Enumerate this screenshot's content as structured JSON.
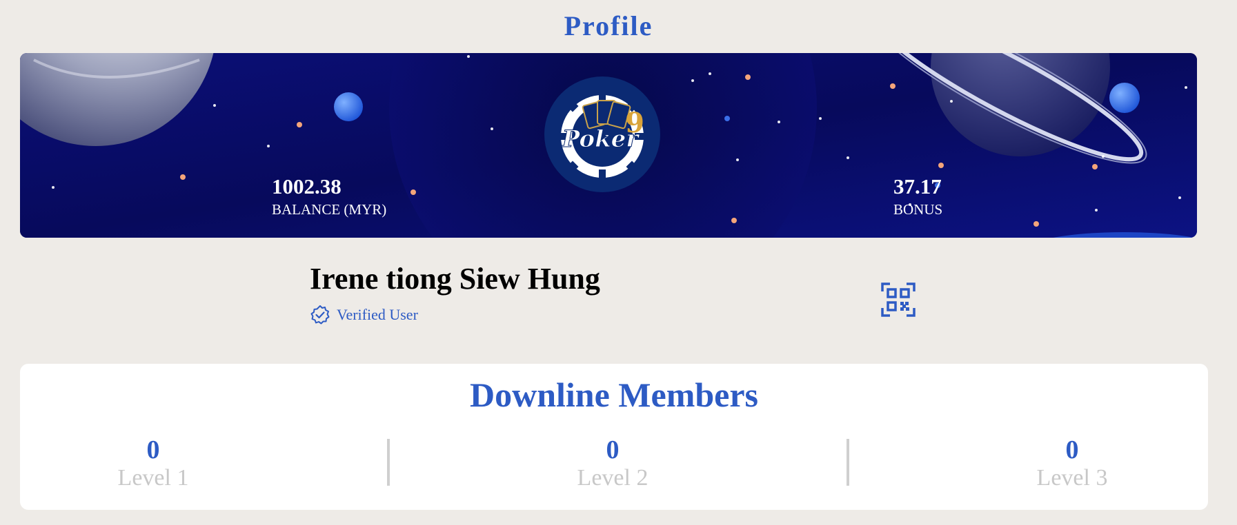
{
  "page": {
    "title": "Profile"
  },
  "banner": {
    "logo_text": "Poker9",
    "balance": {
      "value": "1002.38",
      "label": "BALANCE (MYR)"
    },
    "bonus": {
      "value": "37.17",
      "label": "BONUS"
    }
  },
  "user": {
    "name": "Irene tiong Siew Hung",
    "status": "Verified User",
    "status_icon": "verified-badge-icon",
    "qr_icon": "qr-code-icon"
  },
  "downline": {
    "title": "Downline Members",
    "levels": [
      {
        "count": "0",
        "label": "Level 1"
      },
      {
        "count": "0",
        "label": "Level 2"
      },
      {
        "count": "0",
        "label": "Level 3"
      }
    ]
  },
  "colors": {
    "accent": "#2d5bc4",
    "background": "#eeebe7",
    "banner": "#0a0d6e",
    "muted": "#c8c8c8"
  }
}
